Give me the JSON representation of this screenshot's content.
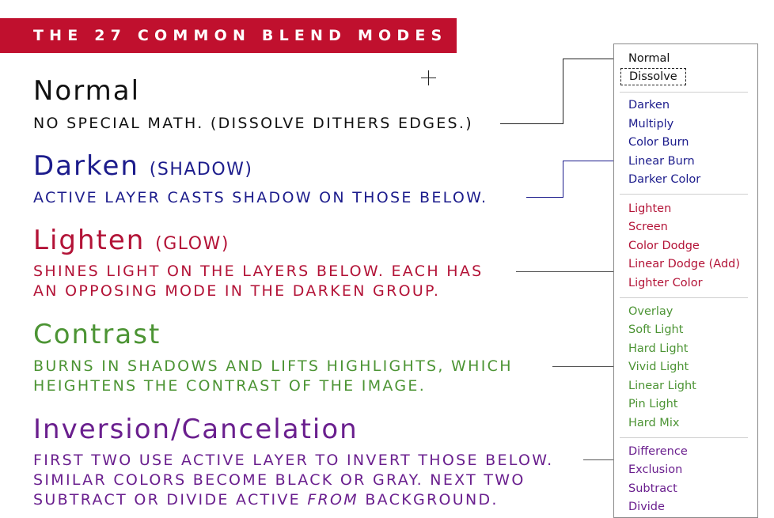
{
  "banner": {
    "title": "THE 27 COMMON BLEND MODES"
  },
  "colors": {
    "banner": "#c0102e",
    "normal": "#111111",
    "darken": "#1c1c8c",
    "lighten": "#b31337",
    "contrast": "#4c9434",
    "inversion": "#6a1f8e"
  },
  "groups": [
    {
      "title": "Normal",
      "subtitle": "",
      "description": "NO SPECIAL MATH. (DISSOLVE DITHERS EDGES.)"
    },
    {
      "title": "Darken",
      "subtitle": "(SHADOW)",
      "description": "ACTIVE LAYER CASTS SHADOW ON THOSE BELOW."
    },
    {
      "title": "Lighten",
      "subtitle": "(GLOW)",
      "description_lines": [
        "SHINES LIGHT ON THE LAYERS BELOW. EACH HAS",
        "AN OPPOSING MODE IN THE DARKEN GROUP."
      ]
    },
    {
      "title": "Contrast",
      "subtitle": "",
      "description_lines": [
        "BURNS IN SHADOWS AND LIFTS HIGHLIGHTS, WHICH",
        "HEIGHTENS THE CONTRAST OF THE IMAGE."
      ]
    },
    {
      "title": "Inversion/Cancelation",
      "subtitle": "",
      "description_lines": [
        "FIRST TWO USE ACTIVE LAYER TO INVERT THOSE BELOW.",
        "SIMILAR COLORS BECOME BLACK OR GRAY. NEXT TWO"
      ],
      "description_line3_pre": "SUBTRACT OR DIVIDE ACTIVE ",
      "description_line3_em": "FROM",
      "description_line3_post": " BACKGROUND."
    }
  ],
  "blend_menu": {
    "selected": "Dissolve",
    "normal_group": [
      "Normal",
      "Dissolve"
    ],
    "darken_group": [
      "Darken",
      "Multiply",
      "Color Burn",
      "Linear Burn",
      "Darker Color"
    ],
    "lighten_group": [
      "Lighten",
      "Screen",
      "Color Dodge",
      "Linear Dodge (Add)",
      "Lighter Color"
    ],
    "contrast_group": [
      "Overlay",
      "Soft Light",
      "Hard Light",
      "Vivid Light",
      "Linear Light",
      "Pin Light",
      "Hard Mix"
    ],
    "inversion_group": [
      "Difference",
      "Exclusion",
      "Subtract",
      "Divide"
    ]
  }
}
